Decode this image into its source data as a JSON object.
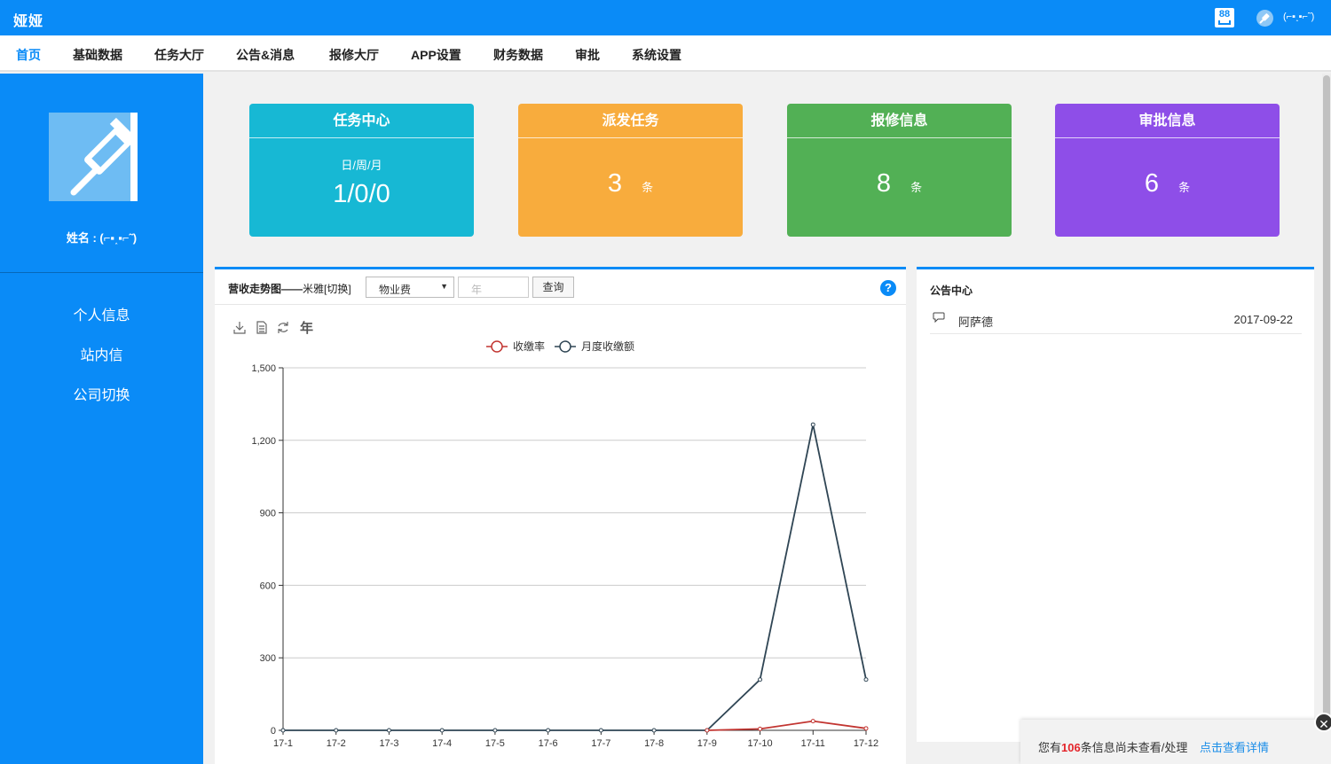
{
  "app": {
    "brand": "娅娅"
  },
  "header": {
    "msg_badge": "88",
    "user": "(⌐▪˰▪⌐˜)"
  },
  "nav": [
    {
      "label": "首页",
      "active": true
    },
    {
      "label": "基础数据"
    },
    {
      "label": "任务大厅"
    },
    {
      "label": "公告&消息"
    },
    {
      "label": "报修大厅"
    },
    {
      "label": "APP设置"
    },
    {
      "label": "财务数据"
    },
    {
      "label": "审批"
    },
    {
      "label": "系统设置"
    }
  ],
  "sidebar": {
    "profile_name": "姓名 : (⌐▪˰▪⌐˜)",
    "menu": [
      {
        "label": "个人信息"
      },
      {
        "label": "站内信"
      },
      {
        "label": "公司切换"
      }
    ]
  },
  "cards": [
    {
      "title": "任务中心",
      "sub": "日/周/月",
      "value": "1/0/0",
      "color": "#17b8d4"
    },
    {
      "title": "派发任务",
      "value": "3",
      "unit": "条",
      "color": "#f8ac3d"
    },
    {
      "title": "报修信息",
      "value": "8",
      "unit": "条",
      "color": "#52b055"
    },
    {
      "title": "审批信息",
      "value": "6",
      "unit": "条",
      "color": "#8e4ee8"
    }
  ],
  "chart_panel": {
    "title": "营收走势图——",
    "subtitle": "米雅[切换]",
    "select_value": "物业费",
    "year_placeholder": "年",
    "query_label": "查询",
    "help": "?",
    "toolbox_year": "年"
  },
  "chart_data": {
    "type": "line",
    "categories": [
      "17-1",
      "17-2",
      "17-3",
      "17-4",
      "17-5",
      "17-6",
      "17-7",
      "17-8",
      "17-9",
      "17-10",
      "17-11",
      "17-12"
    ],
    "series": [
      {
        "name": "收缴率",
        "color": "#c23531",
        "values": [
          null,
          null,
          null,
          null,
          null,
          null,
          null,
          null,
          0,
          6,
          38,
          8
        ]
      },
      {
        "name": "月度收缴额",
        "color": "#2f4554",
        "values": [
          0,
          0,
          0,
          0,
          0,
          0,
          0,
          0,
          0,
          210,
          1265,
          210
        ]
      }
    ],
    "ylim": [
      0,
      1500
    ],
    "yticks": [
      "0",
      "300",
      "600",
      "900",
      "1,200",
      "1,500"
    ],
    "grid": true,
    "legend_position": "top-center"
  },
  "notice": {
    "title": "公告中心",
    "items": [
      {
        "name": "阿萨德",
        "date": "2017-09-22"
      }
    ]
  },
  "toast": {
    "prefix": "您有",
    "count": "106",
    "suffix": "条信息尚未查看/处理",
    "link": "点击查看详情",
    "close": "✕"
  }
}
